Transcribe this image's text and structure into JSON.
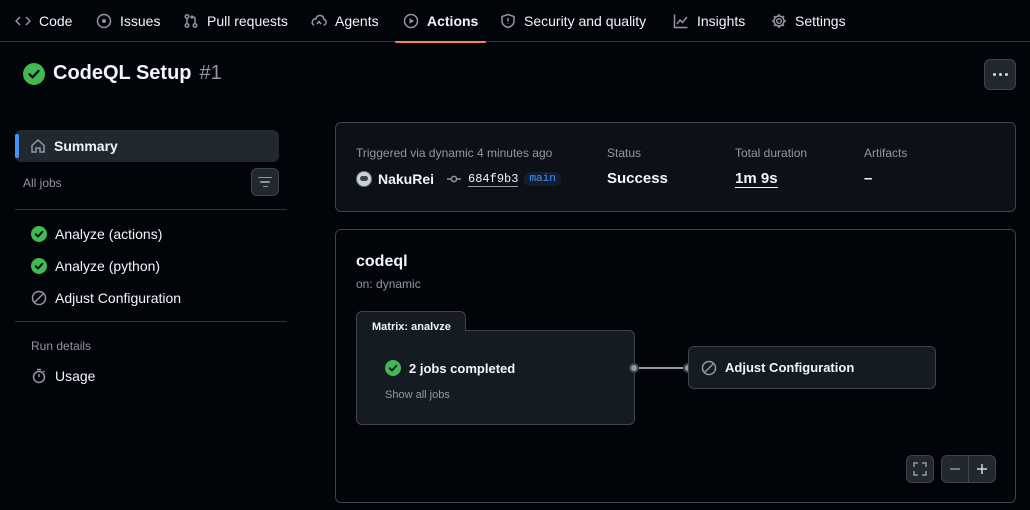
{
  "nav": {
    "tabs": [
      {
        "label": "Code",
        "icon": "code-icon"
      },
      {
        "label": "Issues",
        "icon": "issue-icon"
      },
      {
        "label": "Pull requests",
        "icon": "pull-request-icon"
      },
      {
        "label": "Agents",
        "icon": "agent-icon"
      },
      {
        "label": "Actions",
        "icon": "play-icon",
        "active": true
      },
      {
        "label": "Security and quality",
        "icon": "shield-icon"
      },
      {
        "label": "Insights",
        "icon": "graph-icon"
      },
      {
        "label": "Settings",
        "icon": "gear-icon"
      }
    ],
    "active_color": "#f78166"
  },
  "run": {
    "title": "CodeQL Setup",
    "number": "#1",
    "status_icon": "check-circle-icon",
    "status_color": "#3fb950"
  },
  "sidebar": {
    "summary_label": "Summary",
    "all_jobs_label": "All jobs",
    "jobs": [
      {
        "label": "Analyze (actions)",
        "status": "success"
      },
      {
        "label": "Analyze (python)",
        "status": "success"
      },
      {
        "label": "Adjust Configuration",
        "status": "skipped"
      }
    ],
    "run_details_label": "Run details",
    "usage_label": "Usage"
  },
  "info": {
    "trigger_text": "Triggered via dynamic 4 minutes ago",
    "actor": "NakuRei",
    "commit_sha": "684f9b3",
    "branch": "main",
    "status_label": "Status",
    "status_value": "Success",
    "duration_label": "Total duration",
    "duration_value": "1m 9s",
    "artifacts_label": "Artifacts",
    "artifacts_value": "–"
  },
  "graph": {
    "workflow_name": "codeql",
    "trigger": "on: dynamic",
    "matrix_label": "Matrix: analyze",
    "matrix_status": "2 jobs completed",
    "show_all": "Show all jobs",
    "job_label": "Adjust Configuration"
  }
}
